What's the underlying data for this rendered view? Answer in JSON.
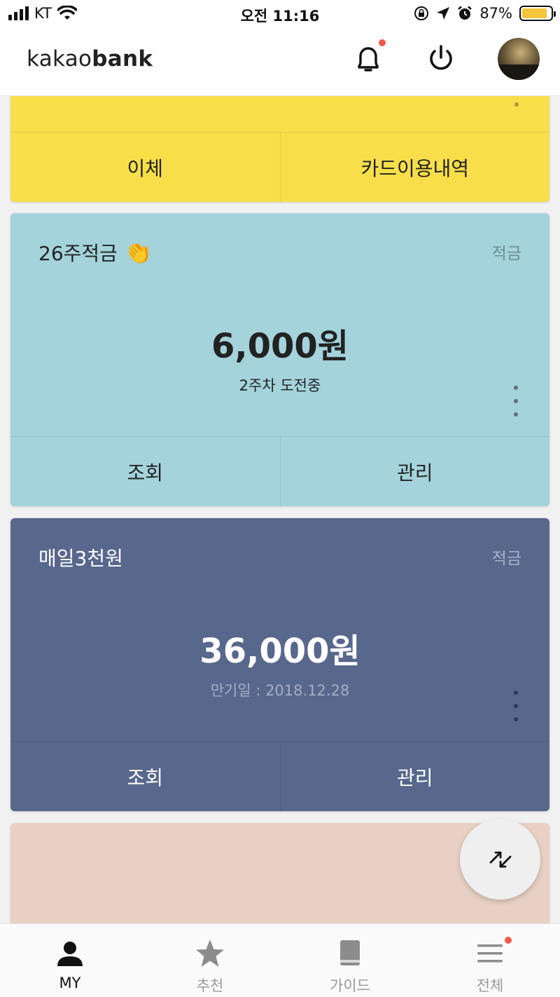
{
  "status_bar": {
    "carrier": "KT",
    "time": "오전 11:16",
    "battery": "87%",
    "battery_level": 0.87
  },
  "header": {
    "logo_light": "kakao",
    "logo_bold": "bank"
  },
  "colors": {
    "yellow_card": "#f8df4a",
    "blue_card": "#a4d3dc",
    "navy_card": "#58678c",
    "pink_card": "#e8d0c4",
    "notification_dot": "#ee5a4a"
  },
  "cards": [
    {
      "actions": [
        "이체",
        "카드이용내역"
      ]
    },
    {
      "title": "26주적금",
      "emoji": "👏",
      "type": "적금",
      "amount": "6,000원",
      "subtitle": "2주차 도전중",
      "actions": [
        "조회",
        "관리"
      ]
    },
    {
      "title": "매일3천원",
      "type": "적금",
      "amount": "36,000원",
      "subtitle": "만기일 : 2018.12.28",
      "actions": [
        "조회",
        "관리"
      ]
    }
  ],
  "tabs": [
    {
      "label": "MY",
      "icon": "person-icon",
      "active": true
    },
    {
      "label": "추천",
      "icon": "star-icon",
      "active": false
    },
    {
      "label": "가이드",
      "icon": "book-icon",
      "active": false
    },
    {
      "label": "전체",
      "icon": "menu-icon",
      "active": false
    }
  ]
}
